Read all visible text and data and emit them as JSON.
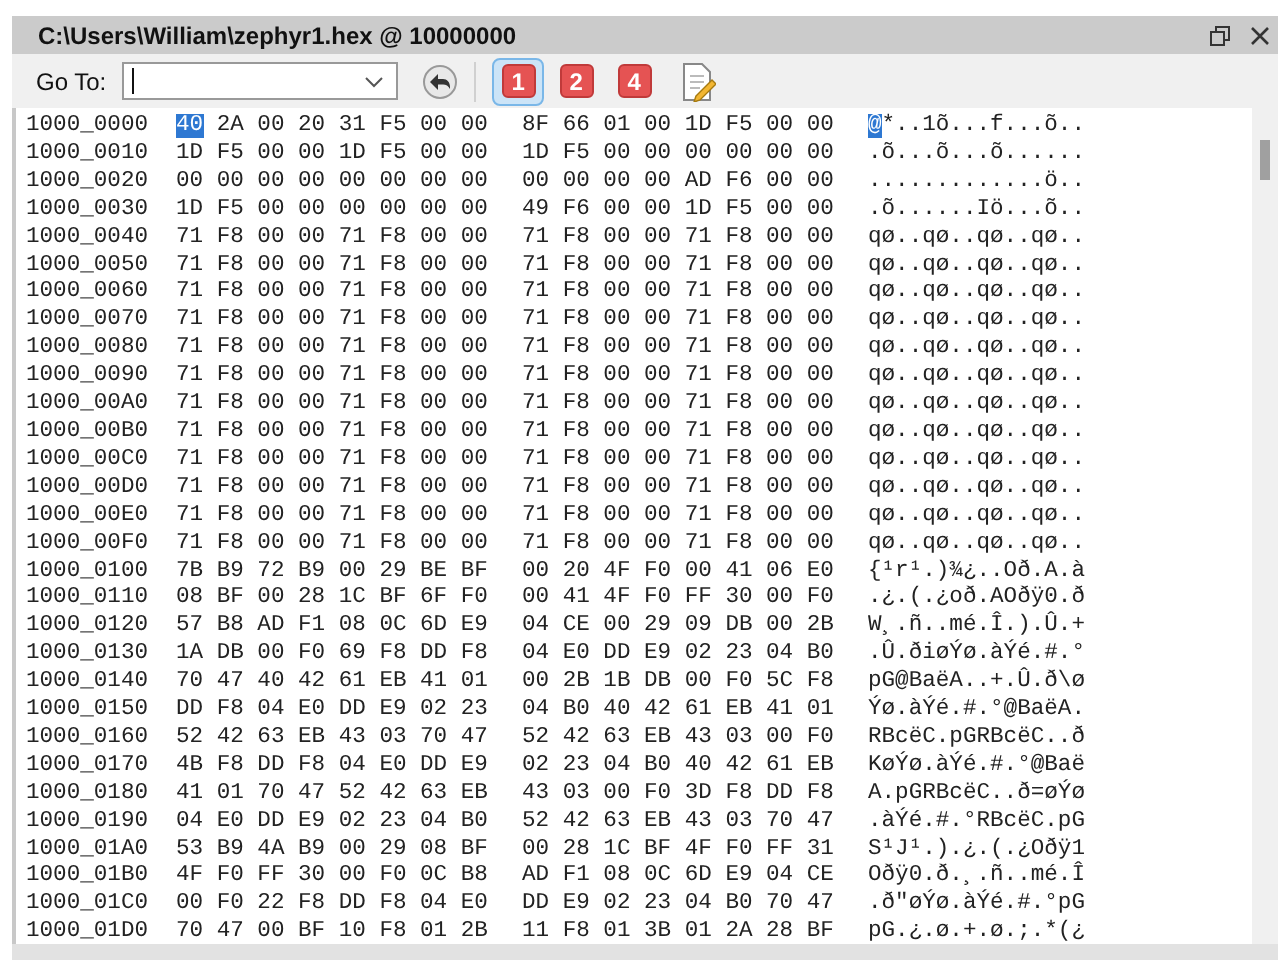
{
  "window": {
    "title": "C:\\Users\\William\\zephyr1.hex @ 10000000"
  },
  "toolbar": {
    "goto_label": "Go To:",
    "buttons": [
      {
        "label": "1",
        "selected": true
      },
      {
        "label": "2",
        "selected": false
      },
      {
        "label": "4",
        "selected": false
      }
    ]
  },
  "rows": [
    {
      "address": "1000_0000",
      "cursor_byte": "40",
      "hex_1": "2A 00 20 31 F5 00 00",
      "hex_2": "8F 66 01 00 1D F5 00 00",
      "cursor_char": "@",
      "ascii": "*..1õ...f...õ.."
    },
    {
      "address": "1000_0010",
      "hex_1": "1D F5 00 00 1D F5 00 00",
      "hex_2": "1D F5 00 00 00 00 00 00",
      "ascii": ".õ...õ...õ......"
    },
    {
      "address": "1000_0020",
      "hex_1": "00 00 00 00 00 00 00 00",
      "hex_2": "00 00 00 00 AD F6 00 00",
      "ascii": ".............ö.."
    },
    {
      "address": "1000_0030",
      "hex_1": "1D F5 00 00 00 00 00 00",
      "hex_2": "49 F6 00 00 1D F5 00 00",
      "ascii": ".õ......Iö...õ.."
    },
    {
      "address": "1000_0040",
      "hex_1": "71 F8 00 00 71 F8 00 00",
      "hex_2": "71 F8 00 00 71 F8 00 00",
      "ascii": "qø..qø..qø..qø.."
    },
    {
      "address": "1000_0050",
      "hex_1": "71 F8 00 00 71 F8 00 00",
      "hex_2": "71 F8 00 00 71 F8 00 00",
      "ascii": "qø..qø..qø..qø.."
    },
    {
      "address": "1000_0060",
      "hex_1": "71 F8 00 00 71 F8 00 00",
      "hex_2": "71 F8 00 00 71 F8 00 00",
      "ascii": "qø..qø..qø..qø.."
    },
    {
      "address": "1000_0070",
      "hex_1": "71 F8 00 00 71 F8 00 00",
      "hex_2": "71 F8 00 00 71 F8 00 00",
      "ascii": "qø..qø..qø..qø.."
    },
    {
      "address": "1000_0080",
      "hex_1": "71 F8 00 00 71 F8 00 00",
      "hex_2": "71 F8 00 00 71 F8 00 00",
      "ascii": "qø..qø..qø..qø.."
    },
    {
      "address": "1000_0090",
      "hex_1": "71 F8 00 00 71 F8 00 00",
      "hex_2": "71 F8 00 00 71 F8 00 00",
      "ascii": "qø..qø..qø..qø.."
    },
    {
      "address": "1000_00A0",
      "hex_1": "71 F8 00 00 71 F8 00 00",
      "hex_2": "71 F8 00 00 71 F8 00 00",
      "ascii": "qø..qø..qø..qø.."
    },
    {
      "address": "1000_00B0",
      "hex_1": "71 F8 00 00 71 F8 00 00",
      "hex_2": "71 F8 00 00 71 F8 00 00",
      "ascii": "qø..qø..qø..qø.."
    },
    {
      "address": "1000_00C0",
      "hex_1": "71 F8 00 00 71 F8 00 00",
      "hex_2": "71 F8 00 00 71 F8 00 00",
      "ascii": "qø..qø..qø..qø.."
    },
    {
      "address": "1000_00D0",
      "hex_1": "71 F8 00 00 71 F8 00 00",
      "hex_2": "71 F8 00 00 71 F8 00 00",
      "ascii": "qø..qø..qø..qø.."
    },
    {
      "address": "1000_00E0",
      "hex_1": "71 F8 00 00 71 F8 00 00",
      "hex_2": "71 F8 00 00 71 F8 00 00",
      "ascii": "qø..qø..qø..qø.."
    },
    {
      "address": "1000_00F0",
      "hex_1": "71 F8 00 00 71 F8 00 00",
      "hex_2": "71 F8 00 00 71 F8 00 00",
      "ascii": "qø..qø..qø..qø.."
    },
    {
      "address": "1000_0100",
      "hex_1": "7B B9 72 B9 00 29 BE BF",
      "hex_2": "00 20 4F F0 00 41 06 E0",
      "ascii": "{¹r¹.)¾¿..Oð.A.à"
    },
    {
      "address": "1000_0110",
      "hex_1": "08 BF 00 28 1C BF 6F F0",
      "hex_2": "00 41 4F F0 FF 30 00 F0",
      "ascii": ".¿.(.¿oð.AOðÿ0.ð"
    },
    {
      "address": "1000_0120",
      "hex_1": "57 B8 AD F1 08 0C 6D E9",
      "hex_2": "04 CE 00 29 09 DB 00 2B",
      "ascii": "W¸.ñ..mé.Î.).Û.+"
    },
    {
      "address": "1000_0130",
      "hex_1": "1A DB 00 F0 69 F8 DD F8",
      "hex_2": "04 E0 DD E9 02 23 04 B0",
      "ascii": ".Û.ðiøÝø.àÝé.#.°"
    },
    {
      "address": "1000_0140",
      "hex_1": "70 47 40 42 61 EB 41 01",
      "hex_2": "00 2B 1B DB 00 F0 5C F8",
      "ascii": "pG@BaëA..+.Û.ð\\ø"
    },
    {
      "address": "1000_0150",
      "hex_1": "DD F8 04 E0 DD E9 02 23",
      "hex_2": "04 B0 40 42 61 EB 41 01",
      "ascii": "Ýø.àÝé.#.°@BaëA."
    },
    {
      "address": "1000_0160",
      "hex_1": "52 42 63 EB 43 03 70 47",
      "hex_2": "52 42 63 EB 43 03 00 F0",
      "ascii": "RBcëC.pGRBcëC..ð"
    },
    {
      "address": "1000_0170",
      "hex_1": "4B F8 DD F8 04 E0 DD E9",
      "hex_2": "02 23 04 B0 40 42 61 EB",
      "ascii": "KøÝø.àÝé.#.°@Baë"
    },
    {
      "address": "1000_0180",
      "hex_1": "41 01 70 47 52 42 63 EB",
      "hex_2": "43 03 00 F0 3D F8 DD F8",
      "ascii": "A.pGRBcëC..ð=øÝø"
    },
    {
      "address": "1000_0190",
      "hex_1": "04 E0 DD E9 02 23 04 B0",
      "hex_2": "52 42 63 EB 43 03 70 47",
      "ascii": ".àÝé.#.°RBcëC.pG"
    },
    {
      "address": "1000_01A0",
      "hex_1": "53 B9 4A B9 00 29 08 BF",
      "hex_2": "00 28 1C BF 4F F0 FF 31",
      "ascii": "S¹J¹.).¿.(.¿Oðÿ1"
    },
    {
      "address": "1000_01B0",
      "hex_1": "4F F0 FF 30 00 F0 0C B8",
      "hex_2": "AD F1 08 0C 6D E9 04 CE",
      "ascii": "Oðÿ0.ð.¸.ñ..mé.Î"
    },
    {
      "address": "1000_01C0",
      "hex_1": "00 F0 22 F8 DD F8 04 E0",
      "hex_2": "DD E9 02 23 04 B0 70 47",
      "ascii": ".ð\"øÝø.àÝé.#.°pG"
    },
    {
      "address": "1000_01D0",
      "hex_1": "70 47 00 BF 10 F8 01 2B",
      "hex_2": "11 F8 01 3B 01 2A 28 BF",
      "ascii": "pG.¿.ø.+.ø.;.*(¿"
    }
  ]
}
